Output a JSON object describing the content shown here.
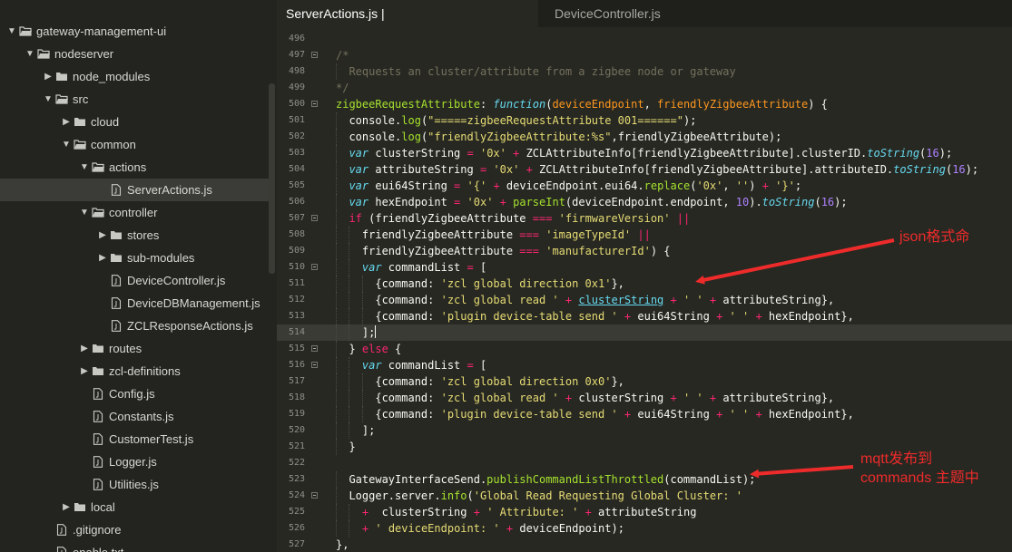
{
  "sidebar": {
    "items": [
      {
        "label": "gateway-management-ui",
        "type": "folder",
        "depth": 0,
        "expanded": true
      },
      {
        "label": "nodeserver",
        "type": "folder",
        "depth": 1,
        "expanded": true
      },
      {
        "label": "node_modules",
        "type": "folder",
        "depth": 2,
        "expanded": false
      },
      {
        "label": "src",
        "type": "folder",
        "depth": 2,
        "expanded": true
      },
      {
        "label": "cloud",
        "type": "folder",
        "depth": 3,
        "expanded": false
      },
      {
        "label": "common",
        "type": "folder",
        "depth": 3,
        "expanded": true
      },
      {
        "label": "actions",
        "type": "folder",
        "depth": 4,
        "expanded": true
      },
      {
        "label": "ServerActions.js",
        "type": "file",
        "depth": 5,
        "selected": true
      },
      {
        "label": "controller",
        "type": "folder",
        "depth": 4,
        "expanded": true
      },
      {
        "label": "stores",
        "type": "folder",
        "depth": 5,
        "expanded": false
      },
      {
        "label": "sub-modules",
        "type": "folder",
        "depth": 5,
        "expanded": false
      },
      {
        "label": "DeviceController.js",
        "type": "file",
        "depth": 5
      },
      {
        "label": "DeviceDBManagement.js",
        "type": "file",
        "depth": 5
      },
      {
        "label": "ZCLResponseActions.js",
        "type": "file",
        "depth": 5
      },
      {
        "label": "routes",
        "type": "folder",
        "depth": 4,
        "expanded": false
      },
      {
        "label": "zcl-definitions",
        "type": "folder",
        "depth": 4,
        "expanded": false
      },
      {
        "label": "Config.js",
        "type": "file",
        "depth": 4
      },
      {
        "label": "Constants.js",
        "type": "file",
        "depth": 4
      },
      {
        "label": "CustomerTest.js",
        "type": "file",
        "depth": 4
      },
      {
        "label": "Logger.js",
        "type": "file",
        "depth": 4
      },
      {
        "label": "Utilities.js",
        "type": "file",
        "depth": 4
      },
      {
        "label": "local",
        "type": "folder",
        "depth": 3,
        "expanded": false
      },
      {
        "label": ".gitignore",
        "type": "file",
        "depth": 2
      },
      {
        "label": "enable.txt",
        "type": "file",
        "depth": 2
      }
    ]
  },
  "tabs": [
    {
      "label": "ServerActions.js | nodeserver......on/actions",
      "active": true
    },
    {
      "label": "DeviceController.js",
      "active": false
    }
  ],
  "editor": {
    "current_line": "514",
    "lines": [
      {
        "n": "496",
        "tokens": []
      },
      {
        "n": "497",
        "fold": true,
        "tokens": [
          [
            "cm",
            "/*"
          ]
        ]
      },
      {
        "n": "498",
        "tokens": [
          [
            "cm",
            "  Requests an cluster/attribute from a zigbee node or gateway"
          ]
        ]
      },
      {
        "n": "499",
        "tokens": [
          [
            "cm",
            "*/"
          ]
        ]
      },
      {
        "n": "500",
        "fold": true,
        "tokens": [
          [
            "fn",
            "zigbeeRequestAttribute"
          ],
          [
            "pl",
            ": "
          ],
          [
            "kw",
            "function"
          ],
          [
            "pl",
            "("
          ],
          [
            "or",
            "deviceEndpoint"
          ],
          [
            "pl",
            ", "
          ],
          [
            "or",
            "friendlyZigbeeAttribute"
          ],
          [
            "pl",
            ") {"
          ]
        ]
      },
      {
        "n": "501",
        "tokens": [
          [
            "pl",
            "  console."
          ],
          [
            "fn",
            "log"
          ],
          [
            "pl",
            "("
          ],
          [
            "str",
            "\"=====zigbeeRequestAttribute 001======\""
          ],
          [
            "pl",
            ");"
          ]
        ]
      },
      {
        "n": "502",
        "tokens": [
          [
            "pl",
            "  console."
          ],
          [
            "fn",
            "log"
          ],
          [
            "pl",
            "("
          ],
          [
            "str",
            "\"friendlyZigbeeAttribute:%s\""
          ],
          [
            "pl",
            ",friendlyZigbeeAttribute);"
          ]
        ]
      },
      {
        "n": "503",
        "tokens": [
          [
            "kw",
            "  var"
          ],
          [
            "pl",
            " clusterString "
          ],
          [
            "op",
            "="
          ],
          [
            "pl",
            " "
          ],
          [
            "str",
            "'0x'"
          ],
          [
            "pl",
            " "
          ],
          [
            "op",
            "+"
          ],
          [
            "pl",
            " ZCLAttributeInfo[friendlyZigbeeAttribute].clusterID."
          ],
          [
            "mth",
            "toString"
          ],
          [
            "pl",
            "("
          ],
          [
            "num",
            "16"
          ],
          [
            "pl",
            ");"
          ]
        ]
      },
      {
        "n": "504",
        "tokens": [
          [
            "kw",
            "  var"
          ],
          [
            "pl",
            " attributeString "
          ],
          [
            "op",
            "="
          ],
          [
            "pl",
            " "
          ],
          [
            "str",
            "'0x'"
          ],
          [
            "pl",
            " "
          ],
          [
            "op",
            "+"
          ],
          [
            "pl",
            " ZCLAttributeInfo[friendlyZigbeeAttribute].attributeID."
          ],
          [
            "mth",
            "toString"
          ],
          [
            "pl",
            "("
          ],
          [
            "num",
            "16"
          ],
          [
            "pl",
            ");"
          ]
        ]
      },
      {
        "n": "505",
        "tokens": [
          [
            "kw",
            "  var"
          ],
          [
            "pl",
            " eui64String "
          ],
          [
            "op",
            "="
          ],
          [
            "pl",
            " "
          ],
          [
            "str",
            "'{'"
          ],
          [
            "pl",
            " "
          ],
          [
            "op",
            "+"
          ],
          [
            "pl",
            " deviceEndpoint.eui64."
          ],
          [
            "fn",
            "replace"
          ],
          [
            "pl",
            "("
          ],
          [
            "str",
            "'0x'"
          ],
          [
            "pl",
            ", "
          ],
          [
            "str",
            "''"
          ],
          [
            "pl",
            ") "
          ],
          [
            "op",
            "+"
          ],
          [
            "pl",
            " "
          ],
          [
            "str",
            "'}'"
          ],
          [
            "pl",
            ";"
          ]
        ]
      },
      {
        "n": "506",
        "tokens": [
          [
            "kw",
            "  var"
          ],
          [
            "pl",
            " hexEndpoint "
          ],
          [
            "op",
            "="
          ],
          [
            "pl",
            " "
          ],
          [
            "str",
            "'0x'"
          ],
          [
            "pl",
            " "
          ],
          [
            "op",
            "+"
          ],
          [
            "pl",
            " "
          ],
          [
            "fn",
            "parseInt"
          ],
          [
            "pl",
            "(deviceEndpoint.endpoint, "
          ],
          [
            "num",
            "10"
          ],
          [
            "pl",
            ")."
          ],
          [
            "mth",
            "toString"
          ],
          [
            "pl",
            "("
          ],
          [
            "num",
            "16"
          ],
          [
            "pl",
            ");"
          ]
        ]
      },
      {
        "n": "507",
        "fold": true,
        "tokens": [
          [
            "op",
            "  if"
          ],
          [
            "pl",
            " (friendlyZigbeeAttribute "
          ],
          [
            "op",
            "==="
          ],
          [
            "pl",
            " "
          ],
          [
            "str",
            "'firmwareVersion'"
          ],
          [
            "pl",
            " "
          ],
          [
            "op",
            "||"
          ]
        ]
      },
      {
        "n": "508",
        "tokens": [
          [
            "pl",
            "    friendlyZigbeeAttribute "
          ],
          [
            "op",
            "==="
          ],
          [
            "pl",
            " "
          ],
          [
            "str",
            "'imageTypeId'"
          ],
          [
            "pl",
            " "
          ],
          [
            "op",
            "||"
          ]
        ]
      },
      {
        "n": "509",
        "tokens": [
          [
            "pl",
            "    friendlyZigbeeAttribute "
          ],
          [
            "op",
            "==="
          ],
          [
            "pl",
            " "
          ],
          [
            "str",
            "'manufacturerId'"
          ],
          [
            "pl",
            ") {"
          ]
        ]
      },
      {
        "n": "510",
        "fold": true,
        "tokens": [
          [
            "kw",
            "    var"
          ],
          [
            "pl",
            " commandList "
          ],
          [
            "op",
            "="
          ],
          [
            "pl",
            " ["
          ]
        ]
      },
      {
        "n": "511",
        "tokens": [
          [
            "pl",
            "      {command: "
          ],
          [
            "str",
            "'zcl global direction 0x1'"
          ],
          [
            "pl",
            "},"
          ]
        ]
      },
      {
        "n": "512",
        "tokens": [
          [
            "pl",
            "      {command: "
          ],
          [
            "str",
            "'zcl global read '"
          ],
          [
            "pl",
            " "
          ],
          [
            "op",
            "+"
          ],
          [
            "pl",
            " "
          ],
          [
            "link",
            "clusterString"
          ],
          [
            "pl",
            " "
          ],
          [
            "op",
            "+"
          ],
          [
            "pl",
            " "
          ],
          [
            "str",
            "' '"
          ],
          [
            "pl",
            " "
          ],
          [
            "op",
            "+"
          ],
          [
            "pl",
            " attributeString},"
          ]
        ]
      },
      {
        "n": "513",
        "tokens": [
          [
            "pl",
            "      {command: "
          ],
          [
            "str",
            "'plugin device-table send '"
          ],
          [
            "pl",
            " "
          ],
          [
            "op",
            "+"
          ],
          [
            "pl",
            " eui64String "
          ],
          [
            "op",
            "+"
          ],
          [
            "pl",
            " "
          ],
          [
            "str",
            "' '"
          ],
          [
            "pl",
            " "
          ],
          [
            "op",
            "+"
          ],
          [
            "pl",
            " hexEndpoint},"
          ]
        ]
      },
      {
        "n": "514",
        "tokens": [
          [
            "pl",
            "    ];"
          ]
        ]
      },
      {
        "n": "515",
        "fold": true,
        "tokens": [
          [
            "pl",
            "  } "
          ],
          [
            "op",
            "else"
          ],
          [
            "pl",
            " {"
          ]
        ]
      },
      {
        "n": "516",
        "fold": true,
        "tokens": [
          [
            "kw",
            "    var"
          ],
          [
            "pl",
            " commandList "
          ],
          [
            "op",
            "="
          ],
          [
            "pl",
            " ["
          ]
        ]
      },
      {
        "n": "517",
        "tokens": [
          [
            "pl",
            "      {command: "
          ],
          [
            "str",
            "'zcl global direction 0x0'"
          ],
          [
            "pl",
            "},"
          ]
        ]
      },
      {
        "n": "518",
        "tokens": [
          [
            "pl",
            "      {command: "
          ],
          [
            "str",
            "'zcl global read '"
          ],
          [
            "pl",
            " "
          ],
          [
            "op",
            "+"
          ],
          [
            "pl",
            " clusterString "
          ],
          [
            "op",
            "+"
          ],
          [
            "pl",
            " "
          ],
          [
            "str",
            "' '"
          ],
          [
            "pl",
            " "
          ],
          [
            "op",
            "+"
          ],
          [
            "pl",
            " attributeString},"
          ]
        ]
      },
      {
        "n": "519",
        "tokens": [
          [
            "pl",
            "      {command: "
          ],
          [
            "str",
            "'plugin device-table send '"
          ],
          [
            "pl",
            " "
          ],
          [
            "op",
            "+"
          ],
          [
            "pl",
            " eui64String "
          ],
          [
            "op",
            "+"
          ],
          [
            "pl",
            " "
          ],
          [
            "str",
            "' '"
          ],
          [
            "pl",
            " "
          ],
          [
            "op",
            "+"
          ],
          [
            "pl",
            " hexEndpoint},"
          ]
        ]
      },
      {
        "n": "520",
        "tokens": [
          [
            "pl",
            "    ];"
          ]
        ]
      },
      {
        "n": "521",
        "tokens": [
          [
            "pl",
            "  }"
          ]
        ]
      },
      {
        "n": "522",
        "tokens": []
      },
      {
        "n": "523",
        "tokens": [
          [
            "pl",
            "  GatewayInterfaceSend."
          ],
          [
            "fn",
            "publishCommandListThrottled"
          ],
          [
            "pl",
            "(commandList);"
          ]
        ]
      },
      {
        "n": "524",
        "fold": true,
        "tokens": [
          [
            "pl",
            "  Logger.server."
          ],
          [
            "fn",
            "info"
          ],
          [
            "pl",
            "("
          ],
          [
            "str",
            "'Global Read Requesting Global Cluster: '"
          ]
        ]
      },
      {
        "n": "525",
        "tokens": [
          [
            "pl",
            "    "
          ],
          [
            "op",
            "+"
          ],
          [
            "pl",
            "  clusterString "
          ],
          [
            "op",
            "+"
          ],
          [
            "pl",
            " "
          ],
          [
            "str",
            "' Attribute: '"
          ],
          [
            "pl",
            " "
          ],
          [
            "op",
            "+"
          ],
          [
            "pl",
            " attributeString"
          ]
        ]
      },
      {
        "n": "526",
        "tokens": [
          [
            "pl",
            "    "
          ],
          [
            "op",
            "+"
          ],
          [
            "pl",
            " "
          ],
          [
            "str",
            "' deviceEndpoint: '"
          ],
          [
            "pl",
            " "
          ],
          [
            "op",
            "+"
          ],
          [
            "pl",
            " deviceEndpoint);"
          ]
        ]
      },
      {
        "n": "527",
        "tokens": [
          [
            "pl",
            "},"
          ]
        ]
      }
    ]
  },
  "annotations": {
    "json_note": "json格式命",
    "mqtt_note_line1": "mqtt发布到",
    "mqtt_note_line2": "commands 主题中",
    "color": "#ee2b2b"
  },
  "colors": {
    "editor_bg": "#272822",
    "sidebar_bg": "#232420",
    "comment": "#75715e",
    "string": "#e6db74",
    "keyword": "#66d9ef",
    "function": "#a6e22e",
    "param": "#fd971f",
    "operator": "#f92672",
    "number": "#ae81ff"
  }
}
